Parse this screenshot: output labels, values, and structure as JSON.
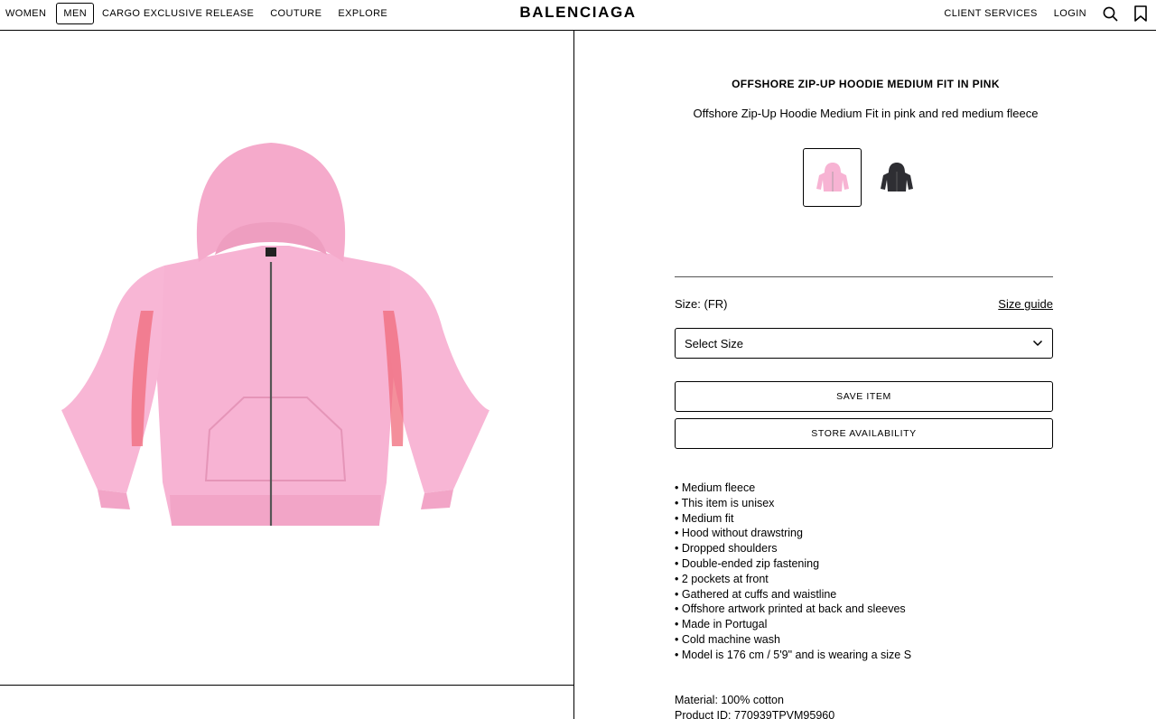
{
  "header": {
    "nav_left": [
      {
        "label": "WOMEN",
        "active": false
      },
      {
        "label": "MEN",
        "active": true
      },
      {
        "label": "CARGO EXCLUSIVE RELEASE",
        "active": false
      },
      {
        "label": "COUTURE",
        "active": false
      },
      {
        "label": "EXPLORE",
        "active": false
      }
    ],
    "logo": "BALENCIAGA",
    "nav_right": {
      "client_services": "CLIENT SERVICES",
      "login": "LOGIN",
      "search_icon": "search-icon",
      "bookmark_icon": "bookmark-icon"
    }
  },
  "product": {
    "title": "OFFSHORE ZIP-UP HOODIE MEDIUM FIT IN PINK",
    "subtitle": "Offshore Zip-Up Hoodie Medium Fit in pink and red medium fleece",
    "image_color": "#f7b3d3",
    "artwork_color": "#f06a7a",
    "swatches": [
      {
        "color": "#f7b3d3",
        "selected": true
      },
      {
        "color": "#2e2e33",
        "selected": false
      }
    ],
    "size_label": "Size: (FR)",
    "size_guide": "Size guide",
    "size_select": "Select Size",
    "save_item": "SAVE ITEM",
    "store_availability": "STORE AVAILABILITY",
    "features": [
      "Medium fleece",
      "This item is unisex",
      "Medium fit",
      "Hood without drawstring",
      "Dropped shoulders",
      "Double-ended zip fastening",
      "2 pockets at front",
      "Gathered at cuffs and waistline",
      "Offshore artwork printed at back and sleeves",
      "Made in Portugal",
      "Cold machine wash",
      "Model is 176 cm / 5'9\" and is wearing a size S"
    ],
    "material": "Material: 100% cotton",
    "product_id": "Product ID: 770939TPVM95960"
  }
}
